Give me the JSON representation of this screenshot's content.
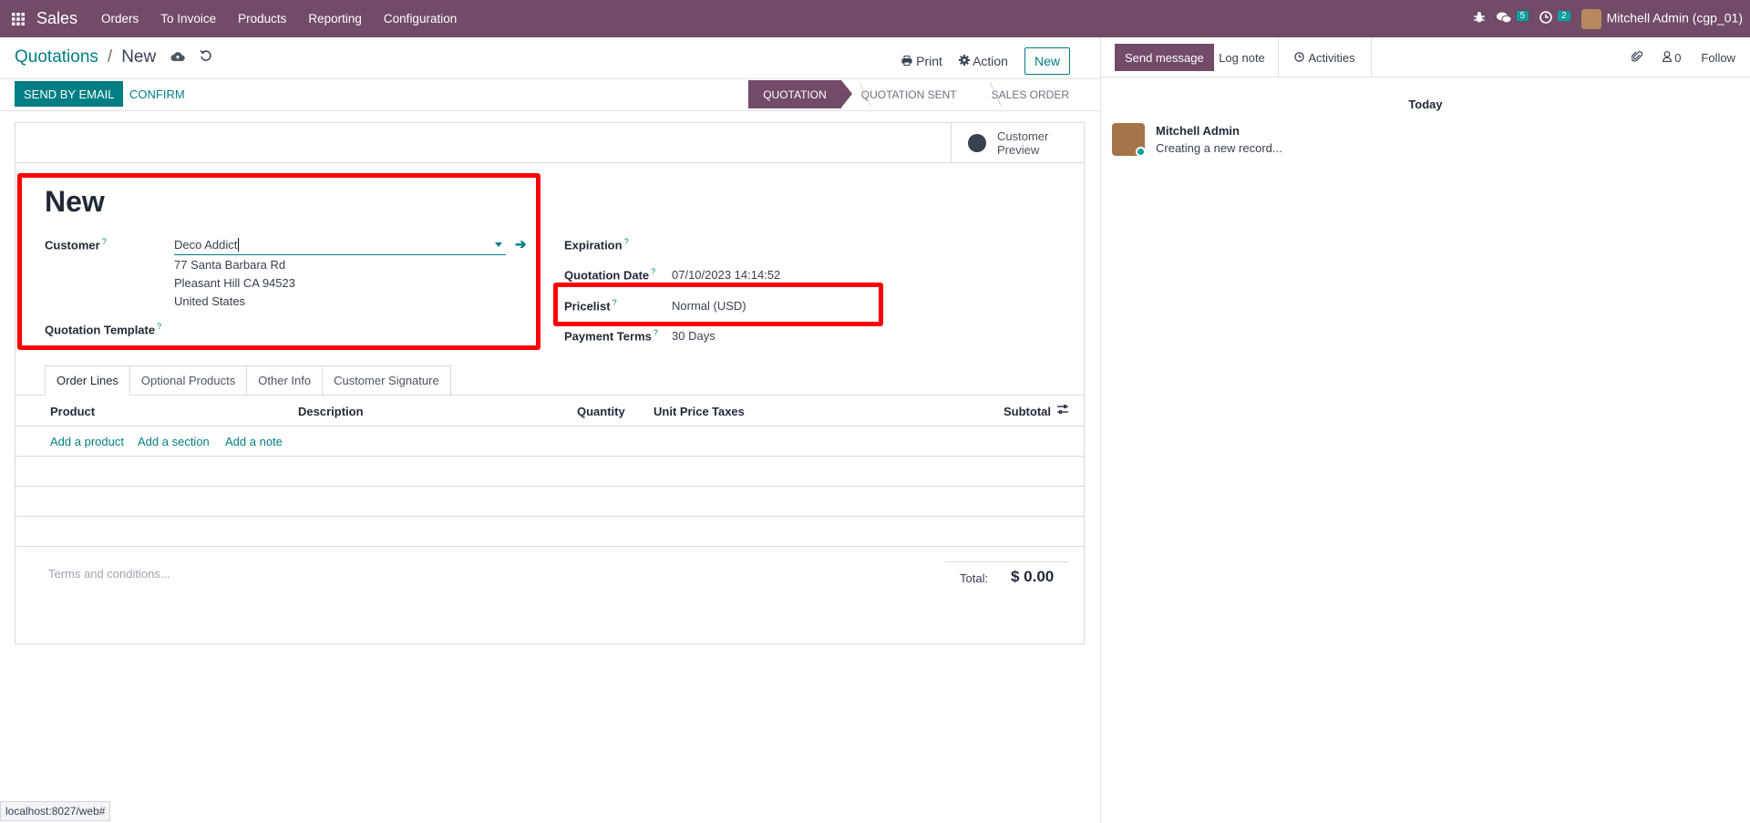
{
  "navbar": {
    "app_name": "Sales",
    "menu": [
      "Orders",
      "To Invoice",
      "Products",
      "Reporting",
      "Configuration"
    ],
    "messages_count": "5",
    "activities_count": "2",
    "user": "Mitchell Admin (cgp_01)"
  },
  "control_panel": {
    "breadcrumb_parent": "Quotations",
    "breadcrumb_sep": "/",
    "breadcrumb_current": "New",
    "print_label": "Print",
    "action_label": "Action",
    "new_label": "New"
  },
  "statusbar": {
    "send_email_label": "SEND BY EMAIL",
    "confirm_label": "CONFIRM",
    "steps": [
      "QUOTATION",
      "QUOTATION SENT",
      "SALES ORDER"
    ],
    "active_step": "QUOTATION"
  },
  "form": {
    "customer_preview_line1": "Customer",
    "customer_preview_line2": "Preview",
    "title": "New",
    "customer_label": "Customer",
    "customer_value": "Deco Addict",
    "address_line1": "77 Santa Barbara Rd",
    "address_line2": "Pleasant Hill CA 94523",
    "address_line3": "United States",
    "template_label": "Quotation Template",
    "expiration_label": "Expiration",
    "quotation_date_label": "Quotation Date",
    "quotation_date_value": "07/10/2023 14:14:52",
    "pricelist_label": "Pricelist",
    "pricelist_value": "Normal (USD)",
    "payment_terms_label": "Payment Terms",
    "payment_terms_value": "30 Days",
    "help_mark": "?"
  },
  "tabs": [
    "Order Lines",
    "Optional Products",
    "Other Info",
    "Customer Signature"
  ],
  "order_lines": {
    "columns": [
      "Product",
      "Description",
      "Quantity",
      "Unit Price",
      "Taxes",
      "Subtotal"
    ],
    "add_product": "Add a product",
    "add_section": "Add a section",
    "add_note": "Add a note"
  },
  "footer": {
    "terms_placeholder": "Terms and conditions...",
    "total_label": "Total:",
    "total_value": "$ 0.00"
  },
  "chatter": {
    "send_message": "Send message",
    "log_note": "Log note",
    "activities": "Activities",
    "followers_count": "0",
    "follow": "Follow",
    "today": "Today",
    "message_author": "Mitchell Admin",
    "message_body": "Creating a new record..."
  },
  "status_url": "localhost:8027/web#",
  "colors": {
    "brand": "#714B67",
    "accent": "#017E84",
    "highlight": "#FF0000"
  }
}
